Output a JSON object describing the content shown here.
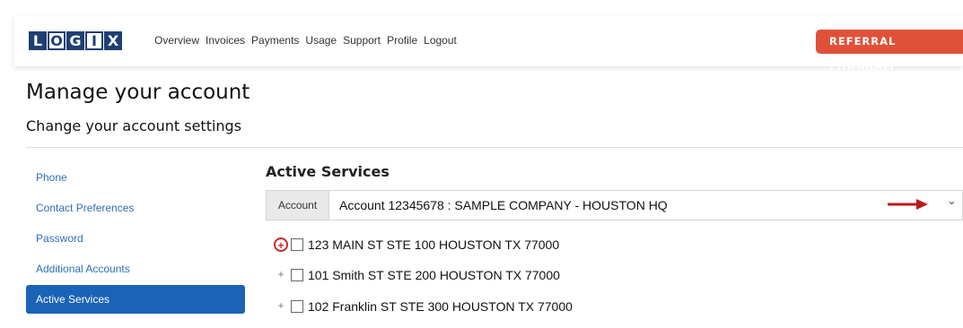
{
  "logo": {
    "letters": [
      "L",
      "O",
      "G",
      "I",
      "X"
    ]
  },
  "nav": {
    "links": [
      "Overview",
      "Invoices",
      "Payments",
      "Usage",
      "Support",
      "Profile",
      "Logout"
    ],
    "referral": "REFERRAL PROGRAM"
  },
  "page": {
    "title": "Manage your account",
    "subtitle": "Change your account settings"
  },
  "sidebar": {
    "items": [
      {
        "label": "Phone",
        "active": false
      },
      {
        "label": "Contact Preferences",
        "active": false
      },
      {
        "label": "Password",
        "active": false
      },
      {
        "label": "Additional Accounts",
        "active": false
      },
      {
        "label": "Active Services",
        "active": true
      }
    ]
  },
  "main": {
    "section_title": "Active Services",
    "account": {
      "label": "Account",
      "value": "Account 12345678 : SAMPLE COMPANY - HOUSTON HQ"
    },
    "services": [
      {
        "expand": "+",
        "address": "123 MAIN ST STE 100 HOUSTON TX 77000",
        "highlighted": true
      },
      {
        "expand": "+",
        "address": "101 Smith ST STE 200 HOUSTON TX 77000",
        "highlighted": false
      },
      {
        "expand": "+",
        "address": "102 Franklin ST STE 300 HOUSTON TX 77000",
        "highlighted": false
      }
    ]
  },
  "colors": {
    "brand": "#1f3f73",
    "referral": "#e1503a",
    "active": "#1a63b8",
    "link": "#2f6fb8",
    "annotation": "#c62828"
  },
  "icons": {
    "dropdown": "chevron-down-icon",
    "annotation": "arrow-right-icon"
  }
}
